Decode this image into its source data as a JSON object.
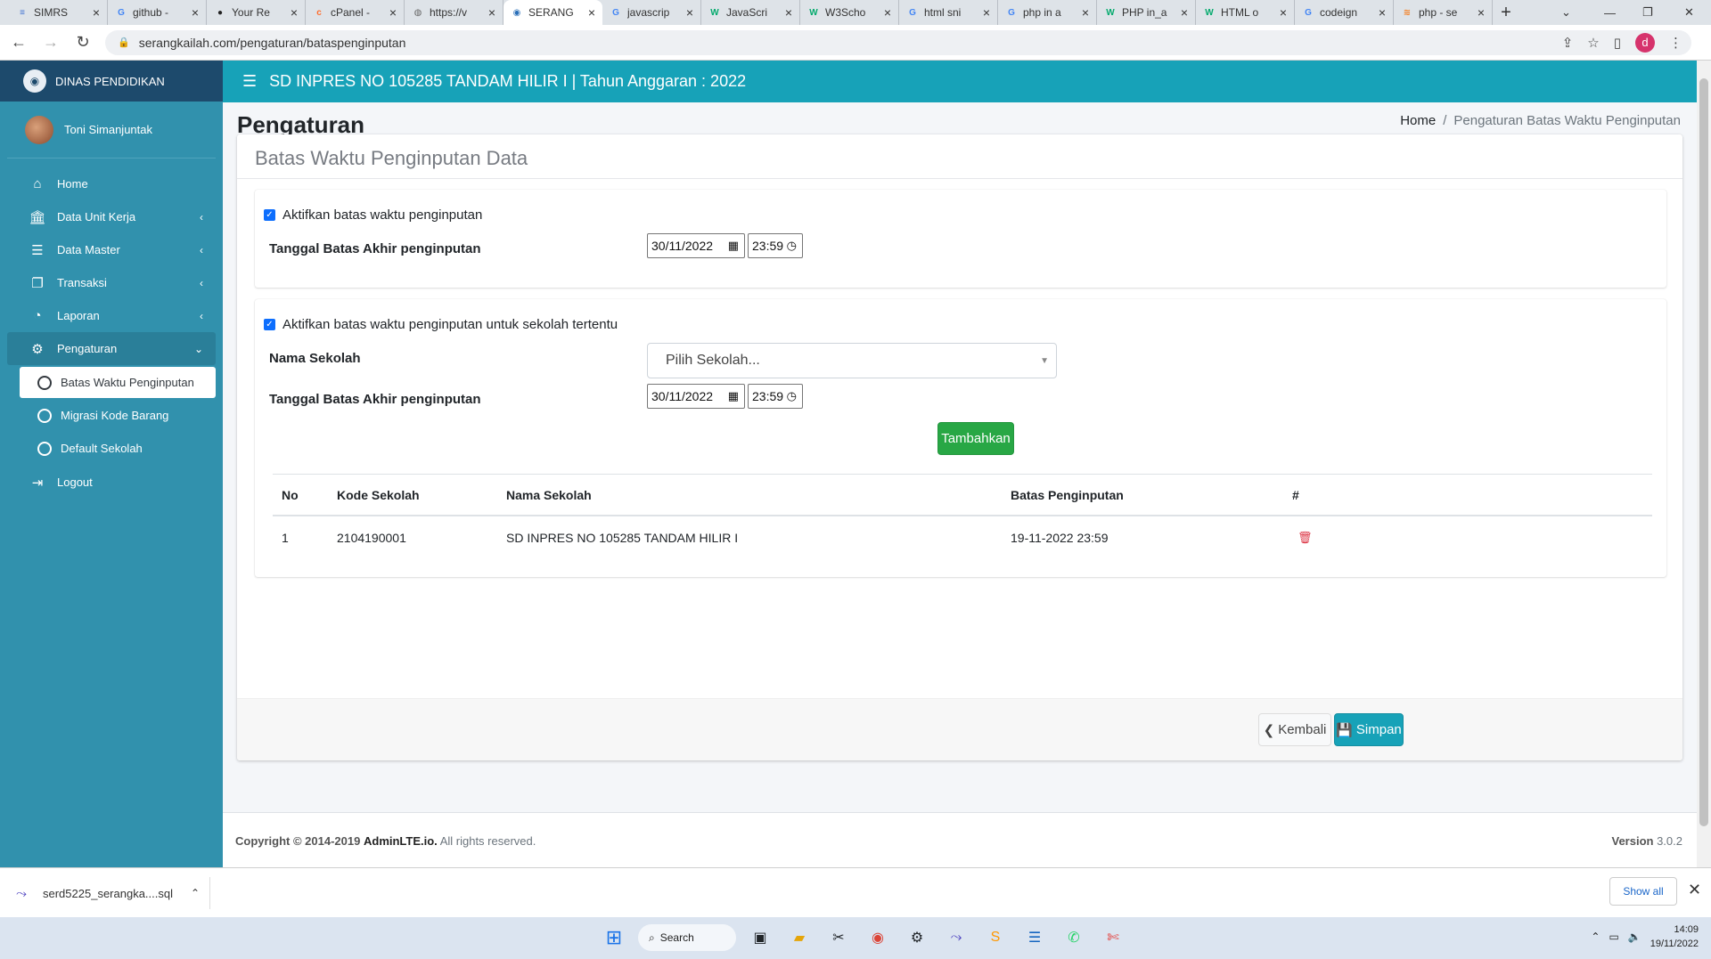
{
  "browser": {
    "tabs": [
      {
        "label": "SIMRS",
        "icon_color": "#3b6fd1",
        "glyph": "≡",
        "active": false
      },
      {
        "label": "github -",
        "icon_color": "#ffffff",
        "glyph": "G",
        "active": false
      },
      {
        "label": "Your Re",
        "icon_color": "#222222",
        "glyph": "●",
        "active": false
      },
      {
        "label": "cPanel -",
        "icon_color": "#ff6c2c",
        "glyph": "c",
        "active": false
      },
      {
        "label": "https://v",
        "icon_color": "#666666",
        "glyph": "◍",
        "active": false
      },
      {
        "label": "SERANG",
        "icon_color": "#2a6fb8",
        "glyph": "◉",
        "active": true
      },
      {
        "label": "javascrip",
        "icon_color": "#ffffff",
        "glyph": "G",
        "active": false
      },
      {
        "label": "JavaScri",
        "icon_color": "#04aa6d",
        "glyph": "W",
        "active": false
      },
      {
        "label": "W3Scho",
        "icon_color": "#04aa6d",
        "glyph": "W",
        "active": false
      },
      {
        "label": "html sni",
        "icon_color": "#ffffff",
        "glyph": "G",
        "active": false
      },
      {
        "label": "php in a",
        "icon_color": "#ffffff",
        "glyph": "G",
        "active": false
      },
      {
        "label": "PHP in_a",
        "icon_color": "#04aa6d",
        "glyph": "W",
        "active": false
      },
      {
        "label": "HTML o",
        "icon_color": "#04aa6d",
        "glyph": "W",
        "active": false
      },
      {
        "label": "codeign",
        "icon_color": "#ffffff",
        "glyph": "G",
        "active": false
      },
      {
        "label": "php - se",
        "icon_color": "#f48024",
        "glyph": "≋",
        "active": false
      }
    ],
    "new_tab": "+",
    "url": "serangkailah.com/pengaturan/bataspenginputan",
    "profile_initial": "d"
  },
  "sidebar": {
    "brand": "DINAS PENDIDIKAN",
    "user": "Toni Simanjuntak",
    "menu": [
      {
        "label": "Home",
        "icon": "home-icon",
        "glyph": "⌂",
        "arrow": ""
      },
      {
        "label": "Data Unit Kerja",
        "icon": "bank-icon",
        "glyph": "🏛",
        "arrow": "‹"
      },
      {
        "label": "Data Master",
        "icon": "database-icon",
        "glyph": "☰",
        "arrow": "‹"
      },
      {
        "label": "Transaksi",
        "icon": "copy-icon",
        "glyph": "❐",
        "arrow": "‹"
      },
      {
        "label": "Laporan",
        "icon": "chart-pie-icon",
        "glyph": "◔",
        "arrow": "‹"
      },
      {
        "label": "Pengaturan",
        "icon": "cogs-icon",
        "glyph": "⚙",
        "arrow": "⌄"
      }
    ],
    "submenu": [
      {
        "label": "Batas Waktu Penginputan",
        "active": true
      },
      {
        "label": "Migrasi Kode Barang",
        "active": false
      },
      {
        "label": "Default Sekolah",
        "active": false
      }
    ],
    "logout": "Logout"
  },
  "topnav": {
    "title": "SD INPRES NO 105285 TANDAM HILIR I | Tahun Anggaran : 2022"
  },
  "page": {
    "title": "Pengaturan",
    "breadcrumb_home": "Home",
    "breadcrumb_sep": "/",
    "breadcrumb_current": "Pengaturan Batas Waktu Penginputan"
  },
  "card": {
    "title": "Batas Waktu Penginputan Data",
    "section1": {
      "checkbox_label": "Aktifkan batas waktu penginputan",
      "checked": true,
      "date_label": "Tanggal Batas Akhir penginputan",
      "date": "30/11/2022",
      "time": "23:59"
    },
    "section2": {
      "checkbox_label": "Aktifkan batas waktu penginputan untuk sekolah tertentu",
      "checked": true,
      "school_label": "Nama Sekolah",
      "school_placeholder": "Pilih Sekolah...",
      "date_label": "Tanggal Batas Akhir penginputan",
      "date": "30/11/2022",
      "time": "23:59",
      "add_button": "Tambahkan",
      "table": {
        "headers": [
          "No",
          "Kode Sekolah",
          "Nama Sekolah",
          "Batas Penginputan",
          "#"
        ],
        "rows": [
          [
            "1",
            "2104190001",
            "SD INPRES NO 105285 TANDAM HILIR I",
            "19-11-2022 23:59",
            ""
          ]
        ]
      }
    },
    "back_button": "Kembali",
    "save_button": "Simpan"
  },
  "footer": {
    "copyright_prefix": "Copyright © 2014-2019",
    "copyright_brand": "AdminLTE.io.",
    "copyright_suffix": "All rights reserved.",
    "version_label": "Version",
    "version": "3.0.2"
  },
  "downloads": {
    "file": "serd5225_serangka....sql",
    "show_all": "Show all"
  },
  "taskbar": {
    "search": "Search",
    "time": "14:09",
    "date": "19/11/2022"
  },
  "colors": {
    "sidebar": "#3191ad",
    "brand_bar": "#1d4a6c",
    "navbar": "#17a2b8",
    "success": "#28a745",
    "danger": "#dc3545"
  }
}
